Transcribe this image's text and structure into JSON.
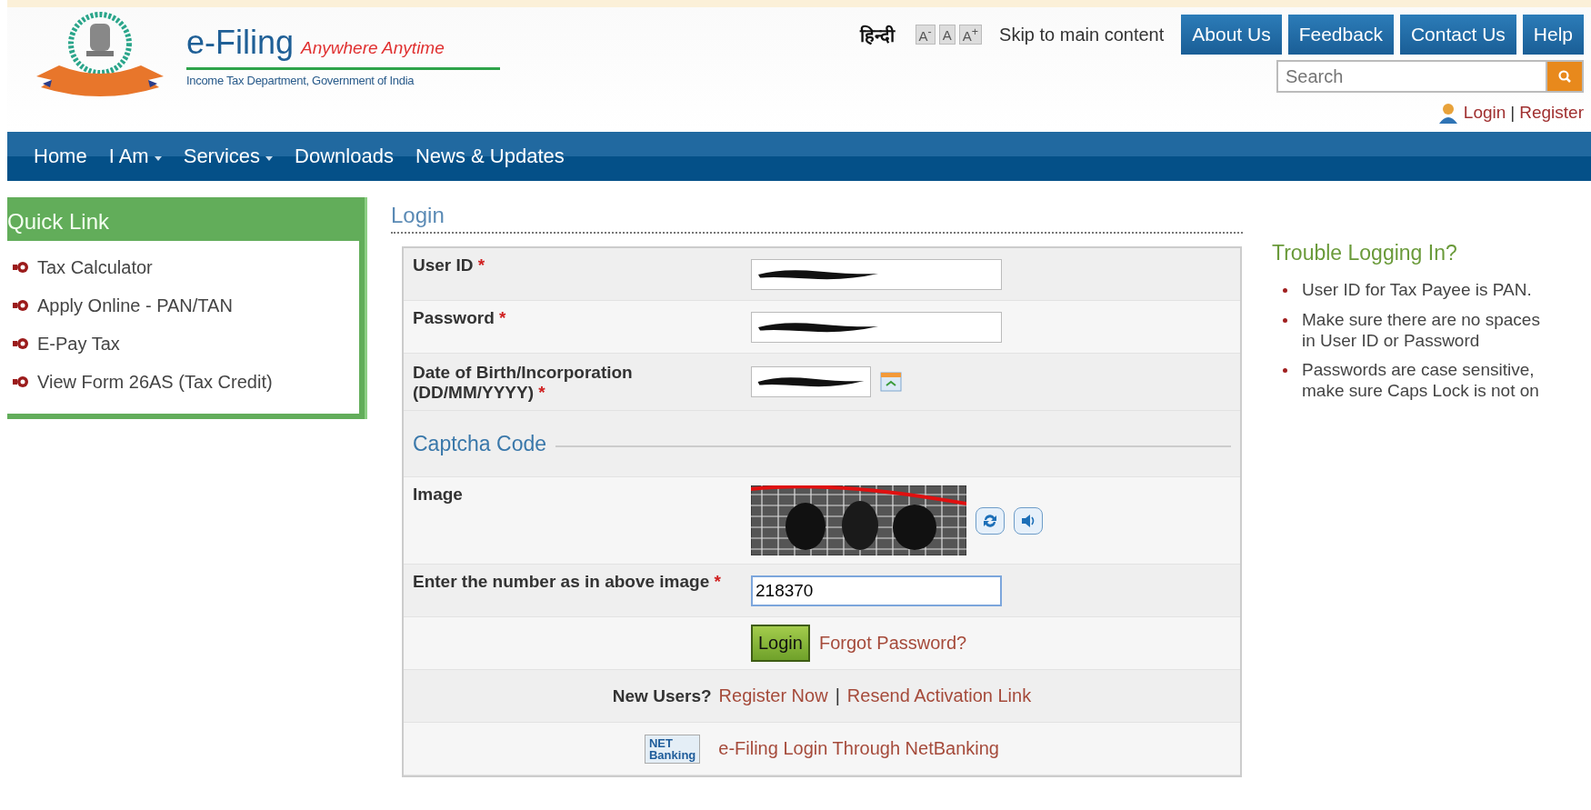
{
  "header": {
    "title": "e-Filing",
    "tagline": "Anywhere Anytime",
    "subtitle": "Income Tax Department, Government of India",
    "language": "हिन्दी",
    "font_sizes": [
      "A$^{-}$",
      "A",
      "A$^{+}$"
    ],
    "skip_link": "Skip to main content",
    "buttons": [
      "About Us",
      "Feedback",
      "Contact Us",
      "Help"
    ],
    "search": {
      "placeholder": "Search"
    },
    "login_link": "Login",
    "separator": "|",
    "register_link": "Register"
  },
  "nav": [
    {
      "label": "Home",
      "dropdown": false
    },
    {
      "label": "I Am",
      "dropdown": true
    },
    {
      "label": "Services",
      "dropdown": true
    },
    {
      "label": "Downloads",
      "dropdown": false
    },
    {
      "label": "News & Updates",
      "dropdown": false
    }
  ],
  "quick_links": {
    "title": "Quick Link",
    "items": [
      "Tax Calculator",
      "Apply Online - PAN/TAN",
      "E-Pay Tax",
      "View Form 26AS (Tax Credit)"
    ]
  },
  "login": {
    "title": "Login",
    "fields": [
      {
        "label": "User ID",
        "required_mark": "*",
        "redacted": true,
        "kind": "text"
      },
      {
        "label": "Password",
        "required_mark": "*",
        "redacted": true,
        "kind": "text"
      },
      {
        "label": "Date of Birth/Incorporation (DD/MM/YYYY)",
        "required_mark": "*",
        "redacted": true,
        "kind": "date"
      }
    ],
    "captcha_heading": "Captcha Code",
    "captcha_label": "Image",
    "answer": {
      "label": "Enter the number as in above image",
      "required_mark": "*",
      "value": "218370"
    },
    "login_button": "Login",
    "forgot_link": "Forgot Password?",
    "new_users": "New Users?",
    "register_now": "Register Now",
    "separator": "|",
    "resend_link": "Resend Activation Link",
    "netbanking_logo": [
      "NET",
      "Banking"
    ],
    "netbanking_link": "e-Filing Login Through NetBanking"
  },
  "help": {
    "title": "Trouble Logging In?",
    "tips": [
      "User ID for Tax Payee is PAN.",
      "Make sure there are no spaces in User ID or Password",
      "Passwords are case sensitive, make sure Caps Lock is not on"
    ]
  }
}
